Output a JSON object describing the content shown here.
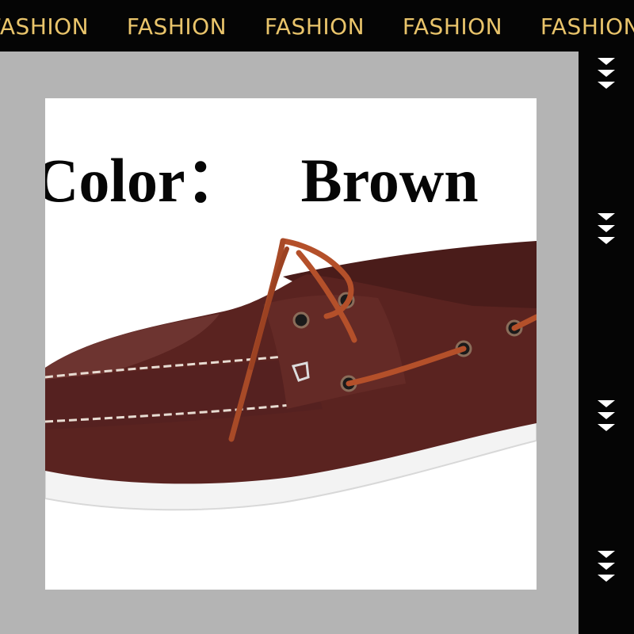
{
  "banner": {
    "words": [
      "FASHION",
      "FASHION",
      "FASHION",
      "FASHION",
      "FASHION"
    ],
    "text_color": "#e9c46b",
    "background": "#050505"
  },
  "side_strip": {
    "icon": "triple-chevron-down-icon",
    "icon_color": "#ffffff"
  },
  "product": {
    "color_label": "Color：",
    "color_value": "Brown",
    "image": "brown-leather-boat-shoe"
  },
  "colors": {
    "page_background": "#b4b4b4",
    "panel_background": "#ffffff",
    "leather": "#5a2320",
    "lace": "#b4502a"
  }
}
